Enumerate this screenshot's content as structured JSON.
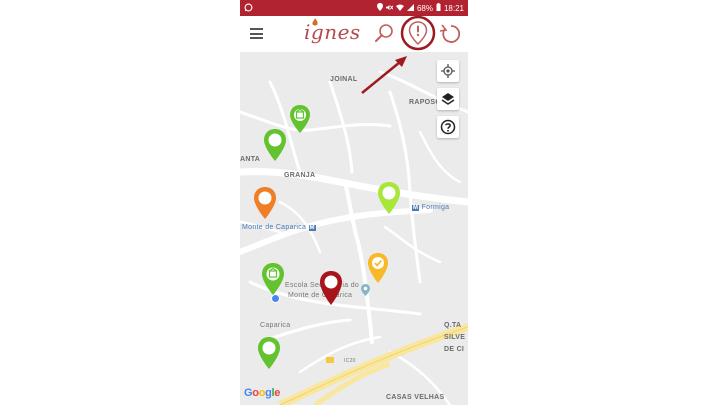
{
  "status_bar": {
    "time": "18:21",
    "battery": "68%"
  },
  "app": {
    "logo_text": "ignes"
  },
  "map": {
    "labels": {
      "joinal": "JOINAL",
      "raposo": "RAPOSO",
      "anta": "ANTA",
      "granja": "GRANJA",
      "formiga": "Formiga",
      "monte_caparica": "Monte de Caparica",
      "escola": "Escola Secundária do",
      "escola2": "Monte de Caparica",
      "caparica": "Caparica",
      "q_ta": "Q.TA",
      "silve": "SILVE",
      "de_ci": "DE CI",
      "casas_velhas": "CASAS VELHAS",
      "ic20": "IC20",
      "metro": "M"
    },
    "attribution": [
      "G",
      "o",
      "o",
      "g",
      "l",
      "e"
    ]
  },
  "colors": {
    "brand_red": "#b12330",
    "pin_green": "#62c32e",
    "pin_lime": "#a8e63a",
    "pin_orange": "#f07e27",
    "pin_yellow": "#f7b928",
    "pin_red": "#a7141b",
    "annotation_red": "#a01820",
    "road_yellow": "#f9e79f"
  }
}
